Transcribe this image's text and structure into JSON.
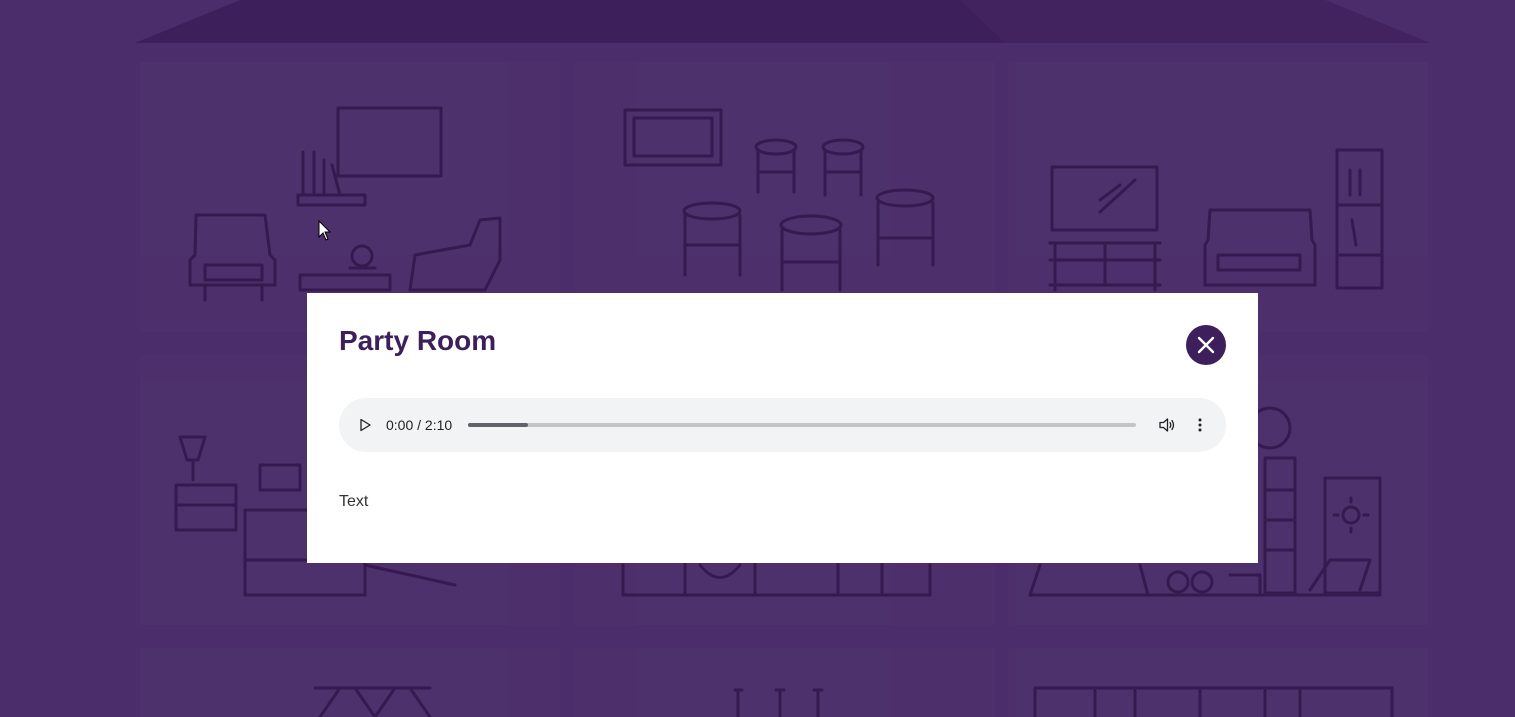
{
  "colors": {
    "background": "#4a2d6a",
    "roof": "#3d1f5c",
    "line_art": "#3a1e58",
    "modal_bg": "#ffffff",
    "title": "#3d1f5c",
    "close_button": "#3d1f5c",
    "player_bg": "#f1f3f4"
  },
  "modal": {
    "title": "Party Room",
    "close_icon": "close-icon",
    "text": "Text"
  },
  "audio": {
    "play_icon": "play-icon",
    "time": "0:00 / 2:10",
    "progress": 0.09,
    "volume_icon": "volume-icon",
    "more_icon": "more-vert-icon"
  }
}
